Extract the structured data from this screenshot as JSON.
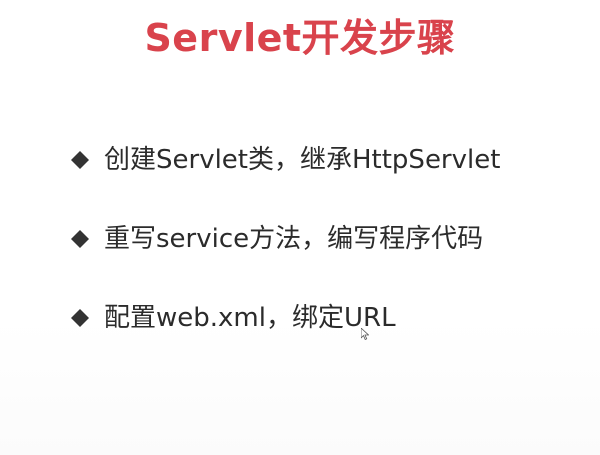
{
  "slide": {
    "title": "Servlet开发步骤",
    "title_color": "#d9434c",
    "bullet_icon": "diamond-icon",
    "bullets": [
      {
        "text": "创建Servlet类，继承HttpServlet"
      },
      {
        "text": "重写service方法，编写程序代码"
      },
      {
        "text": "配置web.xml，绑定URL"
      }
    ]
  },
  "cursor": {
    "icon": "mouse-pointer-icon"
  }
}
